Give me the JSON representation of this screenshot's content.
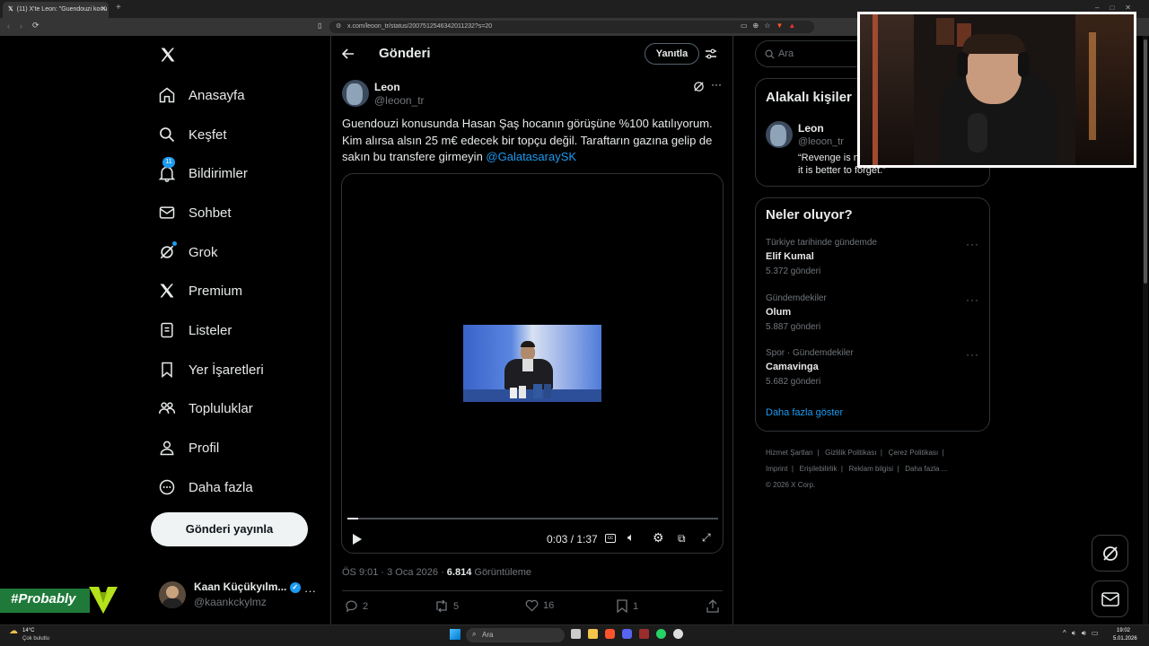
{
  "browser": {
    "tab_title": "(11) X'te Leon: \"Guendouzi konu",
    "url": "x.com/leoon_tr/status/2007512546342011232?s=20"
  },
  "nav": {
    "items": [
      {
        "label": "Anasayfa",
        "icon": "home-icon"
      },
      {
        "label": "Keşfet",
        "icon": "search-icon"
      },
      {
        "label": "Bildirimler",
        "icon": "bell-icon",
        "badge": "11"
      },
      {
        "label": "Sohbet",
        "icon": "mail-icon"
      },
      {
        "label": "Grok",
        "icon": "grok-icon"
      },
      {
        "label": "Premium",
        "icon": "x-logo-icon"
      },
      {
        "label": "Listeler",
        "icon": "list-icon"
      },
      {
        "label": "Yer İşaretleri",
        "icon": "bookmark-icon"
      },
      {
        "label": "Topluluklar",
        "icon": "communities-icon"
      },
      {
        "label": "Profil",
        "icon": "person-icon"
      },
      {
        "label": "Daha fazla",
        "icon": "more-circle-icon"
      }
    ],
    "post_button": "Gönderi yayınla",
    "account": {
      "name": "Kaan Küçükyılm...",
      "handle": "@kaankckylmz"
    }
  },
  "header": {
    "title": "Gönderi",
    "reply_button": "Yanıtla"
  },
  "post": {
    "author": "Leon",
    "handle": "@leoon_tr",
    "text_1": "Guendouzi konusunda Hasan Şaş hocanın görüşüne %100 katılıyorum. Kim alırsa alsın 25 m€ edecek bir topçu değil. Taraftarın gazına gelip de sakın bu transfere girmeyin ",
    "mention": "@GalatasaraySK",
    "time": "ÖS 9:01 · 3 Oca 2026 · ",
    "views": "6.814",
    "views_label": " Görüntüleme",
    "video_time": "0:03 / 1:37",
    "video_progress": 0.03,
    "stats": {
      "replies": "2",
      "reposts": "5",
      "likes": "16",
      "bookmarks": "1"
    }
  },
  "right": {
    "search_placeholder": "Ara",
    "related": {
      "title": "Alakalı kişiler",
      "name": "Leon",
      "handle": "@leoon_tr",
      "bio_1": "“Revenge is n",
      "bio_2": "it is better to forget.”"
    },
    "trends": {
      "title": "Neler oluyor?",
      "items": [
        {
          "context": "Türkiye tarihinde gündemde",
          "name": "Elif Kumal",
          "count": "5.372 gönderi"
        },
        {
          "context": "Gündemdekiler",
          "name": "Olum",
          "count": "5.887 gönderi"
        },
        {
          "context": "Spor · Gündemdekiler",
          "name": "Camavinga",
          "count": "5.682 gönderi"
        }
      ],
      "show_more": "Daha fazla göster"
    },
    "footer": {
      "l1": "Hizmet Şartları",
      "l2": "Gizlilik Politikası",
      "l3": "Çerez Politikası",
      "l4": "Imprint",
      "l5": "Erişilebilirlik",
      "l6": "Reklam bilgisi",
      "l7": "Daha fazla ...",
      "copyright": "© 2026 X Corp."
    }
  },
  "overlay": {
    "hashtag": "#Probably"
  },
  "taskbar": {
    "weather_temp": "14°C",
    "weather_desc": "Çok bulutlu",
    "search": "Ara",
    "time": "19:02",
    "date": "5.01.2026"
  },
  "colors": {
    "accent": "#1d9bf0",
    "background": "#000000",
    "border": "#2f3336",
    "muted": "#71767b",
    "hashtag_bg": "#1f7a3a"
  }
}
